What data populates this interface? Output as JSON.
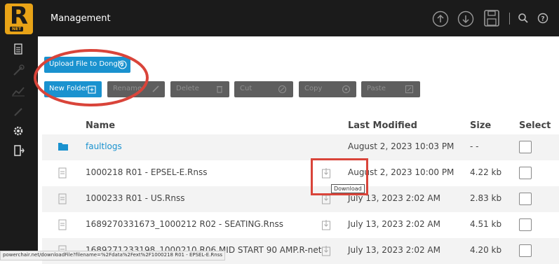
{
  "app": {
    "logo_letter": "R",
    "logo_sub": "NET",
    "title": "Management"
  },
  "sidebar": {
    "icons": [
      "document-icon",
      "wrench-icon",
      "chart-icon",
      "link-icon",
      "gear-icon",
      "logout-icon"
    ]
  },
  "topbar": {
    "icons": [
      "upload-circle-icon",
      "download-circle-icon",
      "save-icon",
      "search-icon",
      "help-icon"
    ]
  },
  "toolbar": {
    "upload_label": "Upload File to Dongle",
    "new_folder_label": "New Folder",
    "rename_label": "Rename",
    "delete_label": "Delete",
    "cut_label": "Cut",
    "copy_label": "Copy",
    "paste_label": "Paste"
  },
  "table": {
    "headers": {
      "name": "Name",
      "last_modified": "Last Modified",
      "size": "Size",
      "select": "Select"
    },
    "rows": [
      {
        "type": "folder",
        "name": "faultlogs",
        "date": "August 2, 2023 10:03 PM",
        "size": "- -"
      },
      {
        "type": "file",
        "name": "1000218 R01 - EPSEL-E.Rnss",
        "date": "August 2, 2023 10:00 PM",
        "size": "4.22 kb"
      },
      {
        "type": "file",
        "name": "1000233 R01 - US.Rnss",
        "date": "July 13, 2023 2:02 AM",
        "size": "2.83 kb"
      },
      {
        "type": "file",
        "name": "1689270331673_1000212 R02 - SEATING.Rnss",
        "date": "July 13, 2023 2:02 AM",
        "size": "4.51 kb"
      },
      {
        "type": "file",
        "name": "1689271233198_1000210 R06 MID START 90 AMP.R-net",
        "date": "July 13, 2023 2:02 AM",
        "size": "4.20 kb"
      }
    ]
  },
  "tooltip": "Download",
  "status_url": "powerchair.net/downloadFile?filename=%2Fdata%2Fext%2F1000218 R01 - EPSEL-E.Rnss",
  "colors": {
    "accent": "#1a92cf",
    "logo": "#e8a317",
    "annotation": "#d9443a",
    "bar": "#1b1b1b"
  }
}
